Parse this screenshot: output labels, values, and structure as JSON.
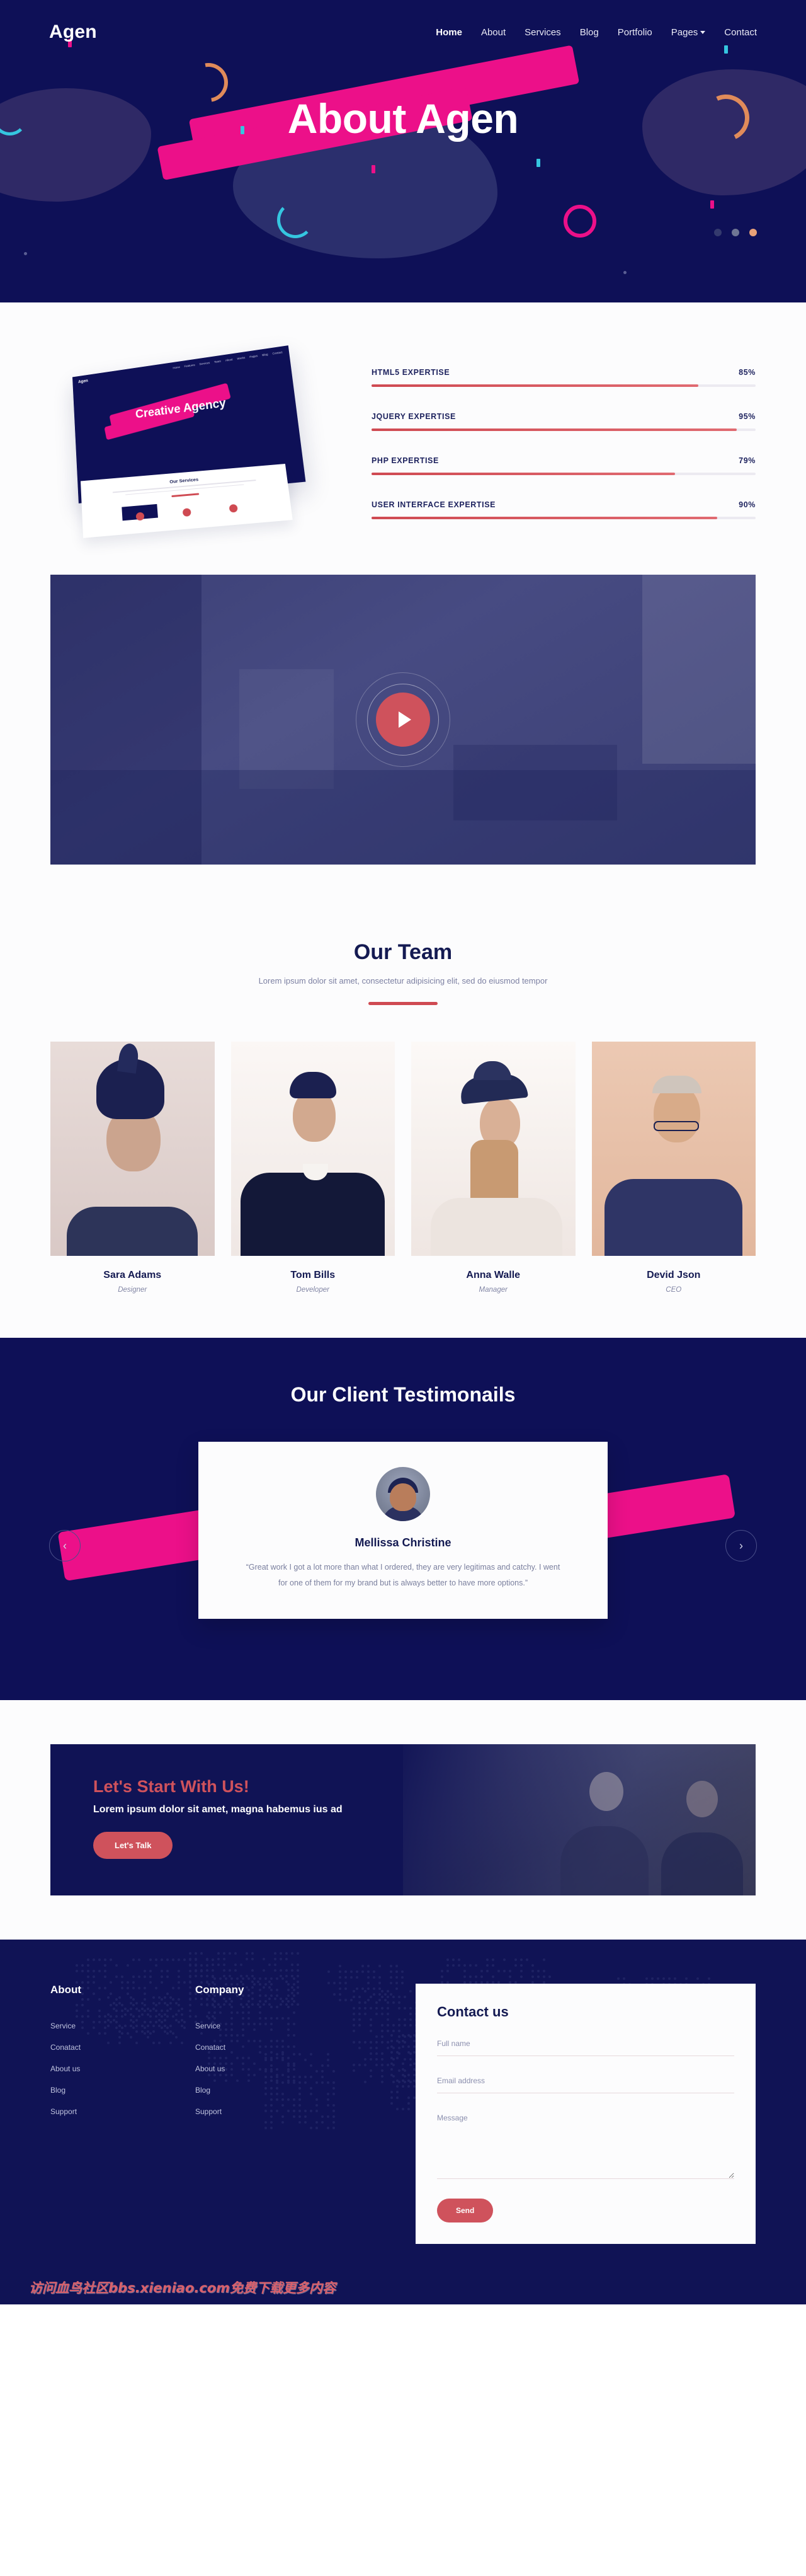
{
  "colors": {
    "navy": "#0e1057",
    "pink": "#ec1089",
    "red": "#cf525c",
    "light": "#fcfcfd",
    "cyan": "#35c6e0",
    "orange": "#e08b5a"
  },
  "nav": {
    "brand": "Agen",
    "links": [
      {
        "label": "Home",
        "active": true
      },
      {
        "label": "About",
        "active": false
      },
      {
        "label": "Services",
        "active": false
      },
      {
        "label": "Blog",
        "active": false
      },
      {
        "label": "Portfolio",
        "active": false
      },
      {
        "label": "Pages",
        "active": false,
        "has_caret": true
      },
      {
        "label": "Contact",
        "active": false
      }
    ]
  },
  "hero": {
    "title": "About Agen",
    "slider_dots": 3,
    "active_dot": 3
  },
  "mockup": {
    "brand": "Agen",
    "title": "Creative Agency",
    "menu": [
      "Home",
      "Features",
      "Services",
      "Team",
      "About",
      "Works",
      "Pages",
      "Blog",
      "Contact"
    ],
    "sheet_title": "Our Services"
  },
  "skills": {
    "items": [
      {
        "label": "HTML5 EXPERTISE",
        "value": 85,
        "display": "85%"
      },
      {
        "label": "JQUERY EXPERTISE",
        "value": 95,
        "display": "95%"
      },
      {
        "label": "PHP EXPERTISE",
        "value": 79,
        "display": "79%"
      },
      {
        "label": "USER INTERFACE EXPERTISE",
        "value": 90,
        "display": "90%"
      }
    ]
  },
  "video": {
    "play_label": "Play video"
  },
  "team": {
    "title": "Our Team",
    "subtitle": "Lorem ipsum dolor sit amet, consectetur adipisicing elit, sed do eiusmod tempor",
    "members": [
      {
        "name": "Sara Adams",
        "role": "Designer"
      },
      {
        "name": "Tom Bills",
        "role": "Developer"
      },
      {
        "name": "Anna Walle",
        "role": "Manager"
      },
      {
        "name": "Devid Json",
        "role": "CEO"
      }
    ]
  },
  "testimonials": {
    "title": "Our Client Testimonails",
    "prev": "‹",
    "next": "›",
    "items": [
      {
        "name": "Mellissa Christine",
        "quote": "“Great work I got a lot more than what I ordered, they are very legitimas and catchy. I went for one of them for my brand but is always better to have more options.”"
      }
    ]
  },
  "cta": {
    "title": "Let's Start With Us!",
    "subtitle": "Lorem ipsum dolor sit amet, magna habemus ius ad",
    "button": "Let's Talk"
  },
  "footer": {
    "columns": [
      {
        "heading": "About",
        "links": [
          "Service",
          "Conatact",
          "About us",
          "Blog",
          "Support"
        ]
      },
      {
        "heading": "Company",
        "links": [
          "Service",
          "Conatact",
          "About us",
          "Blog",
          "Support"
        ]
      }
    ],
    "form": {
      "title": "Contact us",
      "fullname_placeholder": "Full name",
      "fullname_value": "",
      "email_placeholder": "Email address",
      "email_value": "",
      "message_placeholder": "Message",
      "message_value": "",
      "send_label": "Send"
    },
    "watermark": "访问血鸟社区bbs.xieniao.com免费下载更多内容"
  }
}
